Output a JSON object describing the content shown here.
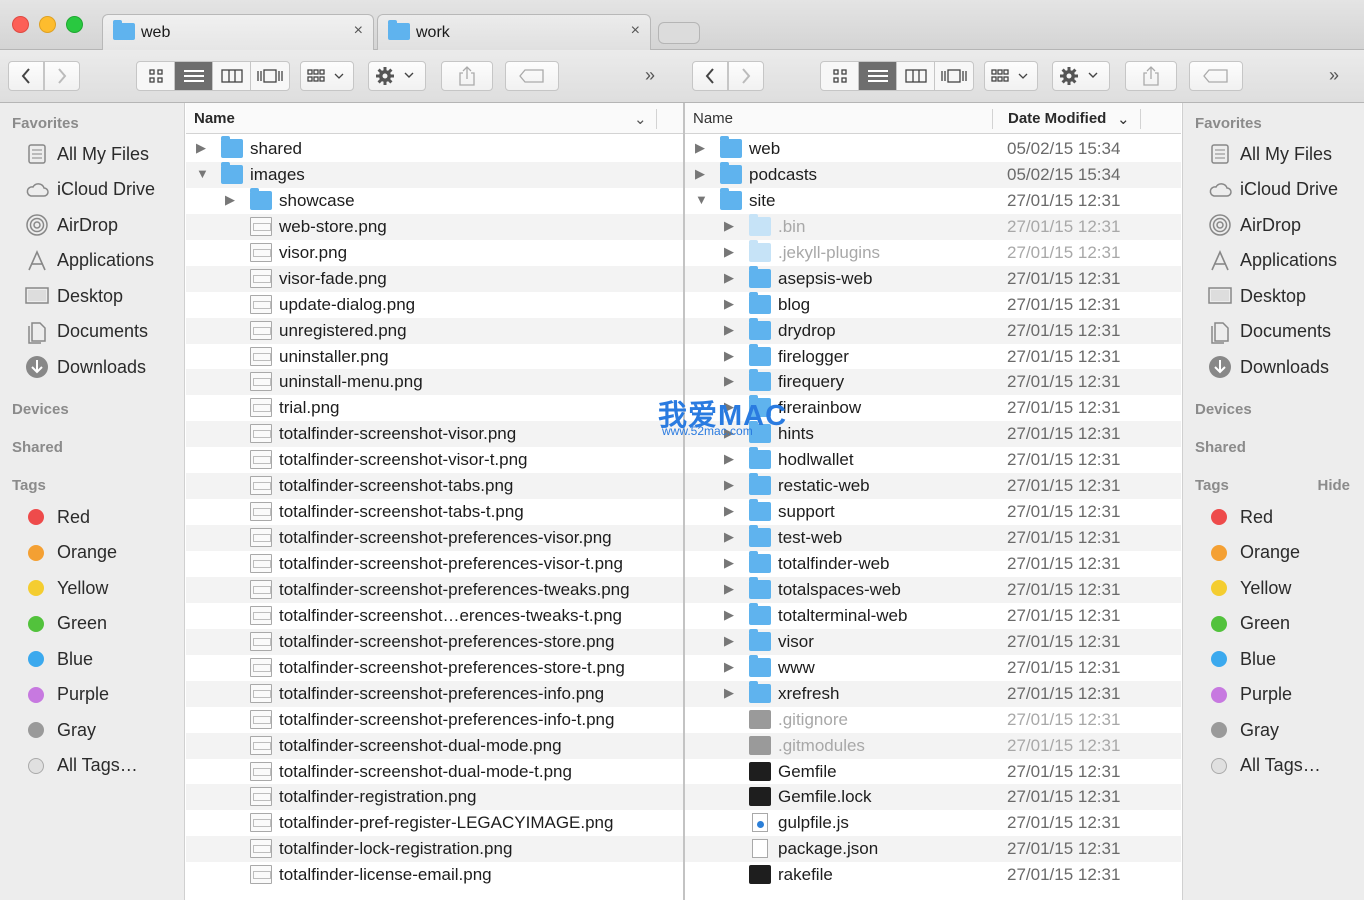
{
  "tabs": [
    {
      "label": "web",
      "close": "×"
    },
    {
      "label": "work",
      "close": "×"
    }
  ],
  "icons": {
    "back": "chevron-left-icon",
    "forward": "chevron-right-icon",
    "icon_view": "grid-icon",
    "list_view": "list-icon",
    "column_view": "columns-icon",
    "coverflow": "coverflow-icon",
    "arrange": "arrange-icon",
    "action": "gear-icon",
    "share": "share-icon",
    "tag": "tag-icon",
    "overflow": "double-chevron-icon"
  },
  "toolbar": {
    "overflow": "»"
  },
  "sidebar": {
    "favorites_header": "Favorites",
    "favorites": [
      {
        "label": "All My Files",
        "icon": "all-my-files-icon"
      },
      {
        "label": "iCloud Drive",
        "icon": "cloud-icon"
      },
      {
        "label": "AirDrop",
        "icon": "airdrop-icon"
      },
      {
        "label": "Applications",
        "icon": "applications-icon"
      },
      {
        "label": "Desktop",
        "icon": "desktop-icon"
      },
      {
        "label": "Documents",
        "icon": "documents-icon"
      },
      {
        "label": "Downloads",
        "icon": "downloads-icon"
      }
    ],
    "devices_header": "Devices",
    "shared_header": "Shared",
    "tags_header": "Tags",
    "hide_label": "Hide",
    "tags": [
      {
        "label": "Red",
        "color": "#ee4b4b"
      },
      {
        "label": "Orange",
        "color": "#f4a033"
      },
      {
        "label": "Yellow",
        "color": "#f4cd30"
      },
      {
        "label": "Green",
        "color": "#52c23c"
      },
      {
        "label": "Blue",
        "color": "#3ba9ee"
      },
      {
        "label": "Purple",
        "color": "#c779e0"
      },
      {
        "label": "Gray",
        "color": "#9a9a9a"
      },
      {
        "label": "All Tags…",
        "color": "#e0e0e0"
      }
    ]
  },
  "left_pane": {
    "header_name": "Name",
    "rows": [
      {
        "name": "shared",
        "type": "folder",
        "level": 0,
        "disc": "▶"
      },
      {
        "name": "images",
        "type": "folder",
        "level": 0,
        "disc": "▼"
      },
      {
        "name": "showcase",
        "type": "folder",
        "level": 1,
        "disc": "▶"
      },
      {
        "name": "web-store.png",
        "type": "image",
        "level": 1
      },
      {
        "name": "visor.png",
        "type": "image",
        "level": 1
      },
      {
        "name": "visor-fade.png",
        "type": "image",
        "level": 1
      },
      {
        "name": "update-dialog.png",
        "type": "image",
        "level": 1
      },
      {
        "name": "unregistered.png",
        "type": "image",
        "level": 1
      },
      {
        "name": "uninstaller.png",
        "type": "image",
        "level": 1
      },
      {
        "name": "uninstall-menu.png",
        "type": "image",
        "level": 1
      },
      {
        "name": "trial.png",
        "type": "image",
        "level": 1
      },
      {
        "name": "totalfinder-screenshot-visor.png",
        "type": "image",
        "level": 1
      },
      {
        "name": "totalfinder-screenshot-visor-t.png",
        "type": "image",
        "level": 1
      },
      {
        "name": "totalfinder-screenshot-tabs.png",
        "type": "image",
        "level": 1
      },
      {
        "name": "totalfinder-screenshot-tabs-t.png",
        "type": "image",
        "level": 1
      },
      {
        "name": "totalfinder-screenshot-preferences-visor.png",
        "type": "image",
        "level": 1
      },
      {
        "name": "totalfinder-screenshot-preferences-visor-t.png",
        "type": "image",
        "level": 1
      },
      {
        "name": "totalfinder-screenshot-preferences-tweaks.png",
        "type": "image",
        "level": 1
      },
      {
        "name": "totalfinder-screenshot…erences-tweaks-t.png",
        "type": "image",
        "level": 1
      },
      {
        "name": "totalfinder-screenshot-preferences-store.png",
        "type": "image",
        "level": 1
      },
      {
        "name": "totalfinder-screenshot-preferences-store-t.png",
        "type": "image",
        "level": 1
      },
      {
        "name": "totalfinder-screenshot-preferences-info.png",
        "type": "image",
        "level": 1
      },
      {
        "name": "totalfinder-screenshot-preferences-info-t.png",
        "type": "image",
        "level": 1
      },
      {
        "name": "totalfinder-screenshot-dual-mode.png",
        "type": "image",
        "level": 1
      },
      {
        "name": "totalfinder-screenshot-dual-mode-t.png",
        "type": "image",
        "level": 1
      },
      {
        "name": "totalfinder-registration.png",
        "type": "image",
        "level": 1
      },
      {
        "name": "totalfinder-pref-register-LEGACYIMAGE.png",
        "type": "image",
        "level": 1
      },
      {
        "name": "totalfinder-lock-registration.png",
        "type": "image",
        "level": 1
      },
      {
        "name": "totalfinder-license-email.png",
        "type": "image",
        "level": 1
      }
    ]
  },
  "right_pane": {
    "header_name": "Name",
    "header_date": "Date Modified",
    "rows": [
      {
        "name": "web",
        "date": "05/02/15 15:34",
        "type": "folder",
        "level": 0,
        "disc": "▶"
      },
      {
        "name": "podcasts",
        "date": "05/02/15 15:34",
        "type": "folder",
        "level": 0,
        "disc": "▶"
      },
      {
        "name": "site",
        "date": "27/01/15 12:31",
        "type": "folder",
        "level": 0,
        "disc": "▼"
      },
      {
        "name": ".bin",
        "date": "27/01/15 12:31",
        "type": "folder",
        "level": 1,
        "disc": "▶",
        "dim": true
      },
      {
        "name": ".jekyll-plugins",
        "date": "27/01/15 12:31",
        "type": "folder",
        "level": 1,
        "disc": "▶",
        "dim": true
      },
      {
        "name": "asepsis-web",
        "date": "27/01/15 12:31",
        "type": "folder",
        "level": 1,
        "disc": "▶"
      },
      {
        "name": "blog",
        "date": "27/01/15 12:31",
        "type": "folder",
        "level": 1,
        "disc": "▶"
      },
      {
        "name": "drydrop",
        "date": "27/01/15 12:31",
        "type": "folder",
        "level": 1,
        "disc": "▶"
      },
      {
        "name": "firelogger",
        "date": "27/01/15 12:31",
        "type": "folder",
        "level": 1,
        "disc": "▶"
      },
      {
        "name": "firequery",
        "date": "27/01/15 12:31",
        "type": "folder",
        "level": 1,
        "disc": "▶"
      },
      {
        "name": "firerainbow",
        "date": "27/01/15 12:31",
        "type": "folder",
        "level": 1,
        "disc": "▶"
      },
      {
        "name": "hints",
        "date": "27/01/15 12:31",
        "type": "folder",
        "level": 1,
        "disc": "▶"
      },
      {
        "name": "hodlwallet",
        "date": "27/01/15 12:31",
        "type": "folder",
        "level": 1,
        "disc": "▶"
      },
      {
        "name": "restatic-web",
        "date": "27/01/15 12:31",
        "type": "folder",
        "level": 1,
        "disc": "▶"
      },
      {
        "name": "support",
        "date": "27/01/15 12:31",
        "type": "folder",
        "level": 1,
        "disc": "▶"
      },
      {
        "name": "test-web",
        "date": "27/01/15 12:31",
        "type": "folder",
        "level": 1,
        "disc": "▶"
      },
      {
        "name": "totalfinder-web",
        "date": "27/01/15 12:31",
        "type": "folder",
        "level": 1,
        "disc": "▶"
      },
      {
        "name": "totalspaces-web",
        "date": "27/01/15 12:31",
        "type": "folder",
        "level": 1,
        "disc": "▶"
      },
      {
        "name": "totalterminal-web",
        "date": "27/01/15 12:31",
        "type": "folder",
        "level": 1,
        "disc": "▶"
      },
      {
        "name": "visor",
        "date": "27/01/15 12:31",
        "type": "folder",
        "level": 1,
        "disc": "▶"
      },
      {
        "name": "www",
        "date": "27/01/15 12:31",
        "type": "folder",
        "level": 1,
        "disc": "▶"
      },
      {
        "name": "xrefresh",
        "date": "27/01/15 12:31",
        "type": "folder",
        "level": 1,
        "disc": "▶"
      },
      {
        "name": ".gitignore",
        "date": "27/01/15 12:31",
        "type": "term",
        "level": 1,
        "dim": true
      },
      {
        "name": ".gitmodules",
        "date": "27/01/15 12:31",
        "type": "term",
        "level": 1,
        "dim": true
      },
      {
        "name": "Gemfile",
        "date": "27/01/15 12:31",
        "type": "term",
        "level": 1
      },
      {
        "name": "Gemfile.lock",
        "date": "27/01/15 12:31",
        "type": "term",
        "level": 1
      },
      {
        "name": "gulpfile.js",
        "date": "27/01/15 12:31",
        "type": "js",
        "level": 1
      },
      {
        "name": "package.json",
        "date": "27/01/15 12:31",
        "type": "doc",
        "level": 1
      },
      {
        "name": "rakefile",
        "date": "27/01/15 12:31",
        "type": "term",
        "level": 1
      }
    ]
  },
  "watermark": {
    "main": "我爱MAC",
    "sub": "www.52mac.com"
  }
}
